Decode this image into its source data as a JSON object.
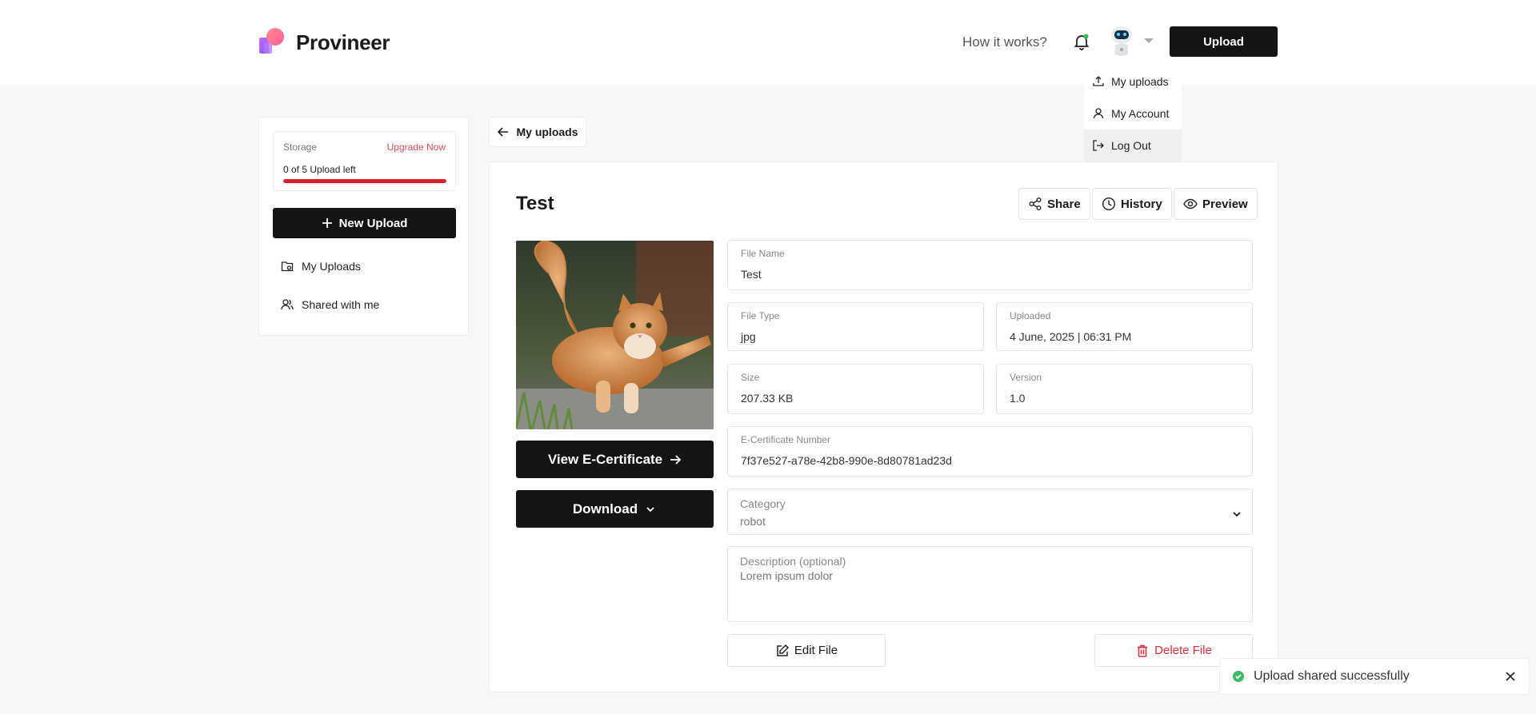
{
  "header": {
    "brand": "Provineer",
    "how_it_works": "How it works?",
    "upload_label": "Upload"
  },
  "user_menu": {
    "items": [
      {
        "label": "My uploads",
        "icon": "upload-icon"
      },
      {
        "label": "My Account",
        "icon": "user-icon"
      },
      {
        "label": "Log Out",
        "icon": "logout-icon"
      }
    ]
  },
  "sidebar": {
    "storage_label": "Storage",
    "upgrade_label": "Upgrade Now",
    "storage_count": "0 of 5 Upload left",
    "storage_used_fraction": 1.0,
    "new_upload_label": "New Upload",
    "items": [
      {
        "label": "My Uploads",
        "icon": "folder-icon"
      },
      {
        "label": "Shared with me",
        "icon": "users-icon"
      }
    ]
  },
  "back_label": "My uploads",
  "file": {
    "title": "Test",
    "actions": {
      "share": "Share",
      "history": "History",
      "preview": "Preview"
    },
    "view_certificate_label": "View E-Certificate",
    "download_label": "Download",
    "fields": {
      "file_name_label": "File Name",
      "file_name": "Test",
      "file_type_label": "File Type",
      "file_type": "jpg",
      "uploaded_label": "Uploaded",
      "uploaded": "4 June, 2025 | 06:31 PM",
      "size_label": "Size",
      "size": "207.33 KB",
      "version_label": "Version",
      "version": "1.0",
      "certificate_label": "E-Certificate Number",
      "certificate": "7f37e527-a78e-42b8-990e-8d80781ad23d",
      "category_label": "Category",
      "category": "robot",
      "description_label": "Description (optional)",
      "description": "Lorem ipsum dolor"
    },
    "edit_label": "Edit File",
    "delete_label": "Delete File"
  },
  "toast": {
    "message": "Upload shared successfully"
  },
  "colors": {
    "accent_dark": "#141414",
    "danger": "#e02b3b",
    "success": "#3dbb67",
    "upgrade": "#e34a5a"
  }
}
